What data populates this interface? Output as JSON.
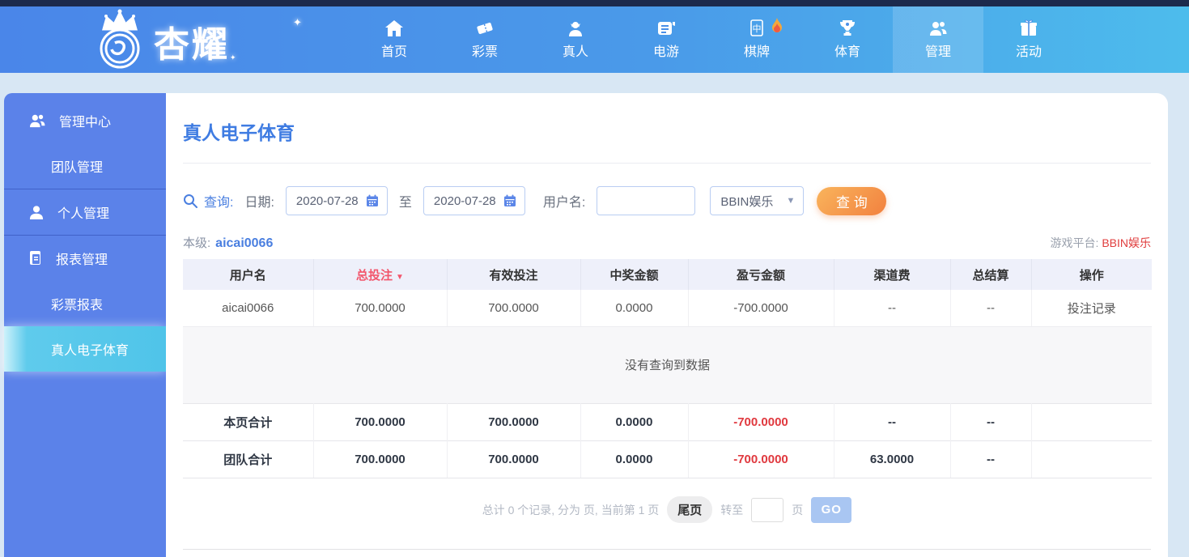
{
  "header": {
    "brand": "杏耀",
    "nav": [
      {
        "label": "首页",
        "icon": "home-icon"
      },
      {
        "label": "彩票",
        "icon": "ticket-icon"
      },
      {
        "label": "真人",
        "icon": "person-icon"
      },
      {
        "label": "电游",
        "icon": "slot-icon"
      },
      {
        "label": "棋牌",
        "icon": "mahjong-icon",
        "hot": true
      },
      {
        "label": "体育",
        "icon": "trophy-icon"
      },
      {
        "label": "管理",
        "icon": "users-icon",
        "active": true
      },
      {
        "label": "活动",
        "icon": "gift-icon"
      }
    ]
  },
  "sidebar": {
    "items": [
      {
        "label": "管理中心",
        "icon": "users-icon"
      },
      {
        "label": "团队管理"
      },
      {
        "label": "个人管理",
        "icon": "user-icon"
      },
      {
        "label": "报表管理",
        "icon": "report-icon"
      },
      {
        "label": "彩票报表"
      },
      {
        "label": "真人电子体育",
        "active": true
      }
    ]
  },
  "main": {
    "title": "真人电子体育",
    "search": {
      "query_label": "查询:",
      "date_label": "日期:",
      "date_from": "2020-07-28",
      "to_label": "至",
      "date_to": "2020-07-28",
      "username_label": "用户名:",
      "username_value": "",
      "platform_selected": "BBIN娱乐",
      "select_arrow": "▼",
      "submit_label": "查 询"
    },
    "level_label": "本级:",
    "level_value": "aicai0066",
    "platform_label": "游戏平台:",
    "platform_value": "BBIN娱乐",
    "table": {
      "columns": [
        "用户名",
        "总投注",
        "有效投注",
        "中奖金额",
        "盈亏金额",
        "渠道费",
        "总结算",
        "操作"
      ],
      "sort_icon": "▼",
      "rows": [
        [
          "aicai0066",
          "700.0000",
          "700.0000",
          "0.0000",
          "-700.0000",
          "--",
          "--",
          "投注记录"
        ]
      ],
      "empty_text": "没有查询到数据",
      "totals": [
        [
          "本页合计",
          "700.0000",
          "700.0000",
          "0.0000",
          "-700.0000",
          "--",
          "--",
          ""
        ],
        [
          "团队合计",
          "700.0000",
          "700.0000",
          "0.0000",
          "-700.0000",
          "63.0000",
          "--",
          ""
        ]
      ]
    },
    "pagination": {
      "summary": "总计 0 个记录, 分为 页, 当前第 1 页",
      "last_page_label": "尾页",
      "goto_label": "转至",
      "page_input_value": "",
      "page_unit": "页",
      "go_label": "GO"
    }
  },
  "colors": {
    "header_gradient_start": "#4a86e9",
    "header_gradient_end": "#4dbcec",
    "top_strip": "#1c2a4d",
    "sidebar_bg": "#5b82e9",
    "sidebar_active": "#4fc4e9",
    "page_bg": "#d8e7f4",
    "accent_blue": "#4a7fe0",
    "accent_red": "#e03c3c",
    "button_orange": "#f2813f",
    "table_header_bg": "#eef0fa"
  }
}
